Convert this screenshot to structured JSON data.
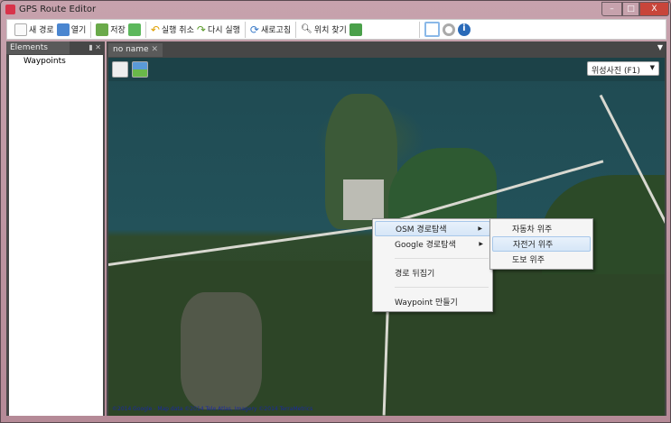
{
  "window": {
    "title": "GPS Route Editor",
    "min": "–",
    "max": "□",
    "close": "X"
  },
  "toolbar": {
    "new_route": "새 경로",
    "open": "열기",
    "save": "저장",
    "undo": "실행 취소",
    "redo": "다시 실행",
    "refresh": "새로고침",
    "find_location": "위치 찾기"
  },
  "panel": {
    "title": "Elements",
    "pin": "▮",
    "close": "✕",
    "items": [
      "Waypoints"
    ]
  },
  "tabs": [
    {
      "label": "no name",
      "close": "✕"
    }
  ],
  "map": {
    "layer_select": "위성사진 (F1)",
    "copyright": "©2014 Google - Map data ©2014 Tele Atlas, Imagery ©2014 TerraMetrics"
  },
  "context_menu": {
    "items": [
      "OSM 경로탐색",
      "Google 경로탐색",
      "경로 뒤집기",
      "Waypoint 만들기"
    ]
  },
  "submenu": {
    "items": [
      "자동차 위주",
      "자전거 위주",
      "도보 위주"
    ]
  }
}
